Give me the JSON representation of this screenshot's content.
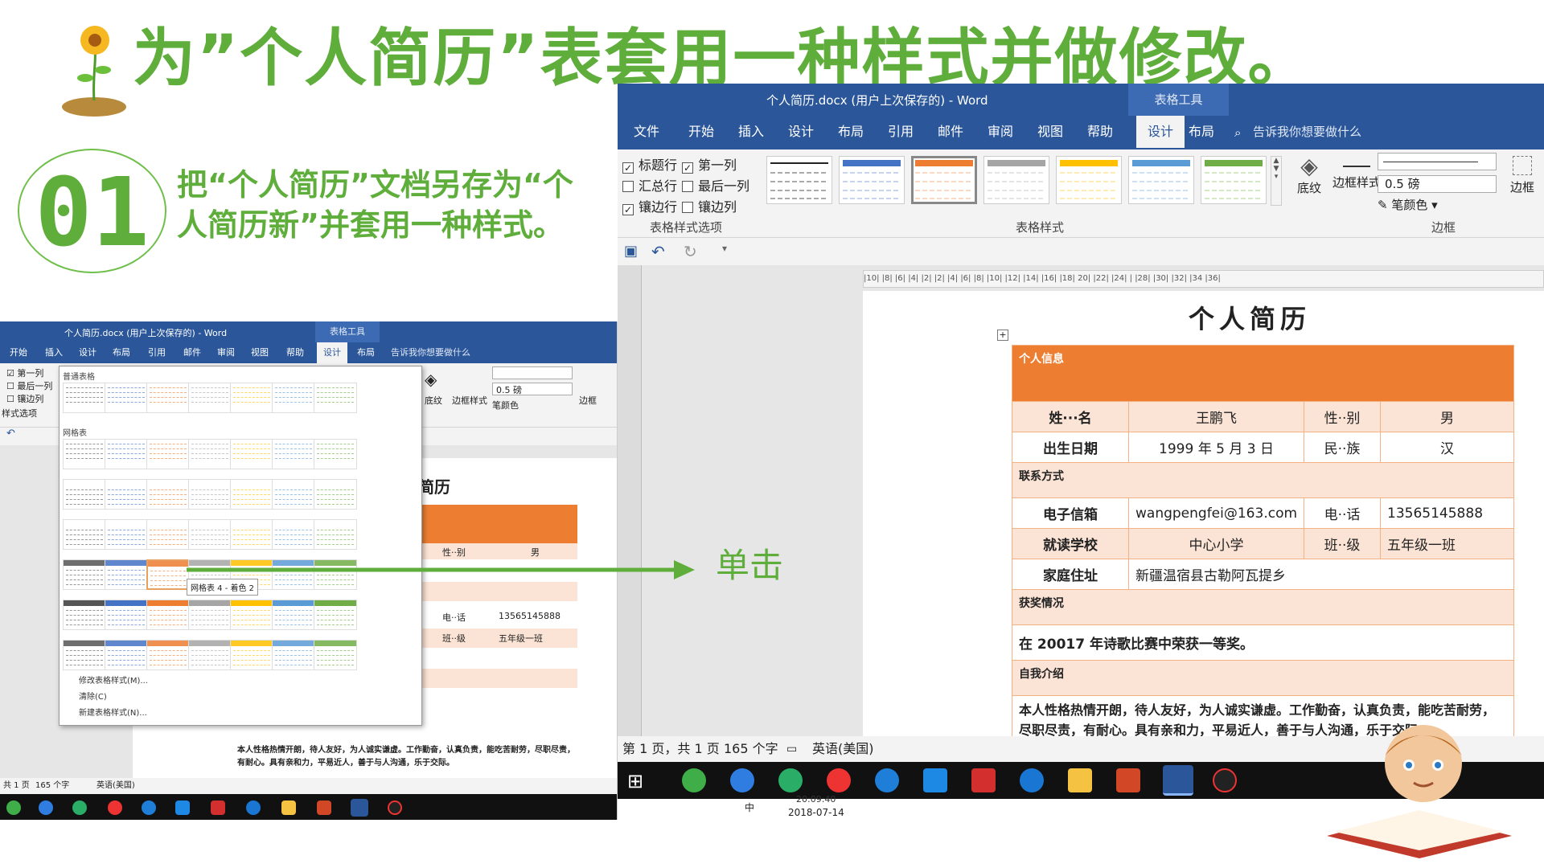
{
  "slide": {
    "title": "为”个人简历”表套用一种样式并做修改。",
    "step_number": "01",
    "step_text": "把“个人简历”文档另存为“个人简历新”并套用一种样式。",
    "arrow_label": "单击"
  },
  "word_right": {
    "title": "个人简历.docx (用户上次保存的)  -  Word",
    "context_tab": "表格工具",
    "tabs": [
      "文件",
      "开始",
      "插入",
      "设计",
      "布局",
      "引用",
      "邮件",
      "审阅",
      "视图",
      "帮助",
      "设计",
      "布局"
    ],
    "tell_me": "告诉我你想要做什么",
    "style_options": {
      "header_row": "标题行",
      "first_column": "第一列",
      "total_row": "汇总行",
      "last_column": "最后一列",
      "banded_rows": "镶边行",
      "banded_columns": "镶边列",
      "group_label": "表格样式选项"
    },
    "styles_group_label": "表格样式",
    "shading_label": "底纹",
    "border_styles_label": "边框样式",
    "pen_weight": "0.5 磅",
    "pen_color_label": "笔颜色",
    "borders_label": "边框",
    "borders_group_label": "边框",
    "ruler_text": "|10|  |8|  |6|  |4|  |2|        |2|  |4|  |6|  |8|  |10|  |12|  |14|  |16|  |18|  20|  |22|  |24|  |   |28|  |30|  |32|  |34  |36|",
    "status": {
      "page": "第 1 页，共 1 页",
      "words": "165 个字",
      "language": "英语(美国)"
    }
  },
  "document": {
    "heading": "个人简历",
    "section_personal": "个人信息",
    "name_label": "姓···名",
    "name_value": "王鹏飞",
    "gender_label": "性··别",
    "gender_value": "男",
    "birth_label": "出生日期",
    "birth_value": "1999 年 5 月 3 日",
    "ethnic_label": "民··族",
    "ethnic_value": "汉",
    "section_contact": "联系方式",
    "email_label": "电子信箱",
    "email_value": "wangpengfei@163.com",
    "phone_label": "电··话",
    "phone_value": "13565145888",
    "school_label": "就读学校",
    "school_value": "中心小学",
    "class_label": "班··级",
    "class_value": "五年级一班",
    "address_label": "家庭住址",
    "address_value": "新疆温宿县古勒阿瓦提乡",
    "section_awards": "获奖情况",
    "awards_text": "在 20017 年诗歌比赛中荣获一等奖。",
    "section_intro": "自我介绍",
    "intro_text": "本人性格热情开朗，待人友好，为人诚实谦虚。工作勤奋，认真负责，能吃苦耐劳，尽职尽责，有耐心。具有亲和力，平易近人，善于与人沟通，乐于交际。"
  },
  "word_left": {
    "title": "个人简历.docx (用户上次保存的)  -  Word",
    "context_tab": "表格工具",
    "tabs": [
      "开始",
      "插入",
      "设计",
      "布局",
      "引用",
      "邮件",
      "审阅",
      "视图",
      "帮助",
      "设计",
      "布局"
    ],
    "tell_me": "告诉我你想要做什么",
    "opt_first_col": "第一列",
    "opt_last_col": "最后一列",
    "opt_banded_col": "镶边列",
    "opt_group": "样式选项",
    "gallery_plain": "普通表格",
    "gallery_grid": "网格表",
    "tooltip": "网格表 4 - 着色 2",
    "menu_modify": "修改表格样式(M)...",
    "menu_clear": "清除(C)",
    "menu_new": "新建表格样式(N)...",
    "shading": "底纹",
    "border_styles": "边框样式",
    "pen_weight": "0.5 磅",
    "pen_color": "笔颜色",
    "borders": "边框",
    "doc_heading": "简历",
    "gender_label": "性··别",
    "gender_value": "男",
    "phone_label": "电··话",
    "phone_value": "13565145888",
    "class_label": "班··级",
    "class_value": "五年级一班",
    "intro_text": "本人性格热情开朗，待人友好，为人诚实谦虚。工作勤奋，认真负责，能吃苦耐劳，尽职尽责，有耐心。具有亲和力，平易近人，善于与人沟通，乐于交际。",
    "status": {
      "page": "共 1 页",
      "words": "165 个字",
      "language": "英语(美国)"
    }
  },
  "taskbar": {
    "time": "20:09:40",
    "date": "2018-07-14",
    "ime": "中"
  },
  "colors": {
    "word_blue": "#2b579a",
    "accent_green": "#5fae3c",
    "table_orange": "#ed7d31",
    "table_light": "#fbe4d5"
  }
}
